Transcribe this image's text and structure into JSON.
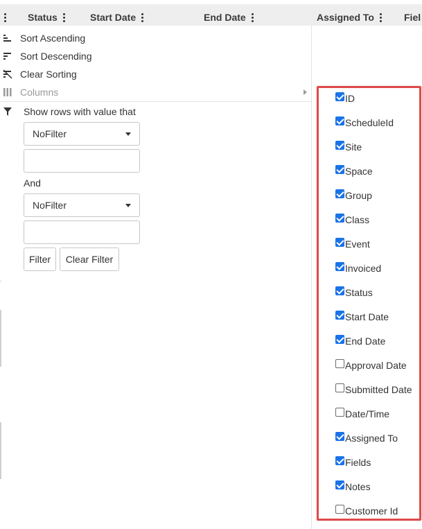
{
  "grid": {
    "columns": [
      {
        "id": "status",
        "label": "Status"
      },
      {
        "id": "start_date",
        "label": "Start Date"
      },
      {
        "id": "end_date",
        "label": "End Date"
      },
      {
        "id": "assigned_to",
        "label": "Assigned To"
      },
      {
        "id": "fields",
        "label": "Fiel"
      }
    ]
  },
  "menu": {
    "sort_ascending": "Sort Ascending",
    "sort_descending": "Sort Descending",
    "clear_sorting": "Clear Sorting",
    "columns": "Columns"
  },
  "filter": {
    "title": "Show rows with value that",
    "operator1": "NoFilter",
    "value1": "",
    "joiner": "And",
    "operator2": "NoFilter",
    "value2": "",
    "filter_button": "Filter",
    "clear_button": "Clear Filter"
  },
  "column_chooser": {
    "items": [
      {
        "label": "ID",
        "checked": true
      },
      {
        "label": "ScheduleId",
        "checked": true
      },
      {
        "label": "Site",
        "checked": true
      },
      {
        "label": "Space",
        "checked": true
      },
      {
        "label": "Group",
        "checked": true
      },
      {
        "label": "Class",
        "checked": true
      },
      {
        "label": "Event",
        "checked": true
      },
      {
        "label": "Invoiced",
        "checked": true
      },
      {
        "label": "Status",
        "checked": true
      },
      {
        "label": "Start Date",
        "checked": true
      },
      {
        "label": "End Date",
        "checked": true
      },
      {
        "label": "Approval Date",
        "checked": false
      },
      {
        "label": "Submitted Date",
        "checked": false
      },
      {
        "label": "Date/Time",
        "checked": false
      },
      {
        "label": "Assigned To",
        "checked": true
      },
      {
        "label": "Fields",
        "checked": true
      },
      {
        "label": "Notes",
        "checked": true
      },
      {
        "label": "Customer Id",
        "checked": false
      }
    ]
  },
  "colors": {
    "highlight_border": "#e04a4a",
    "checkbox_checked": "#1a73e8",
    "header_bg": "#eeeeee"
  }
}
